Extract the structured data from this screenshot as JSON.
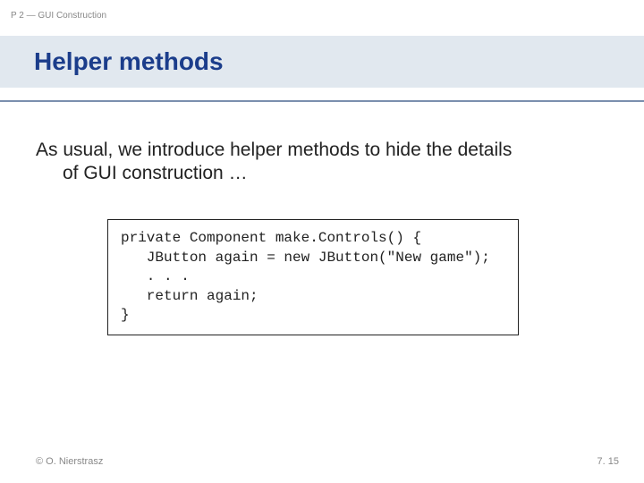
{
  "breadcrumb": "P 2 — GUI Construction",
  "title": "Helper methods",
  "body": {
    "line1": "As usual, we introduce helper methods to hide the details",
    "line2": "of GUI construction …"
  },
  "code": "private Component make.Controls() {\n   JButton again = new JButton(\"New game\");\n   . . .\n   return again;\n}",
  "footer": {
    "left": "© O. Nierstrasz",
    "right": "7. 15"
  }
}
